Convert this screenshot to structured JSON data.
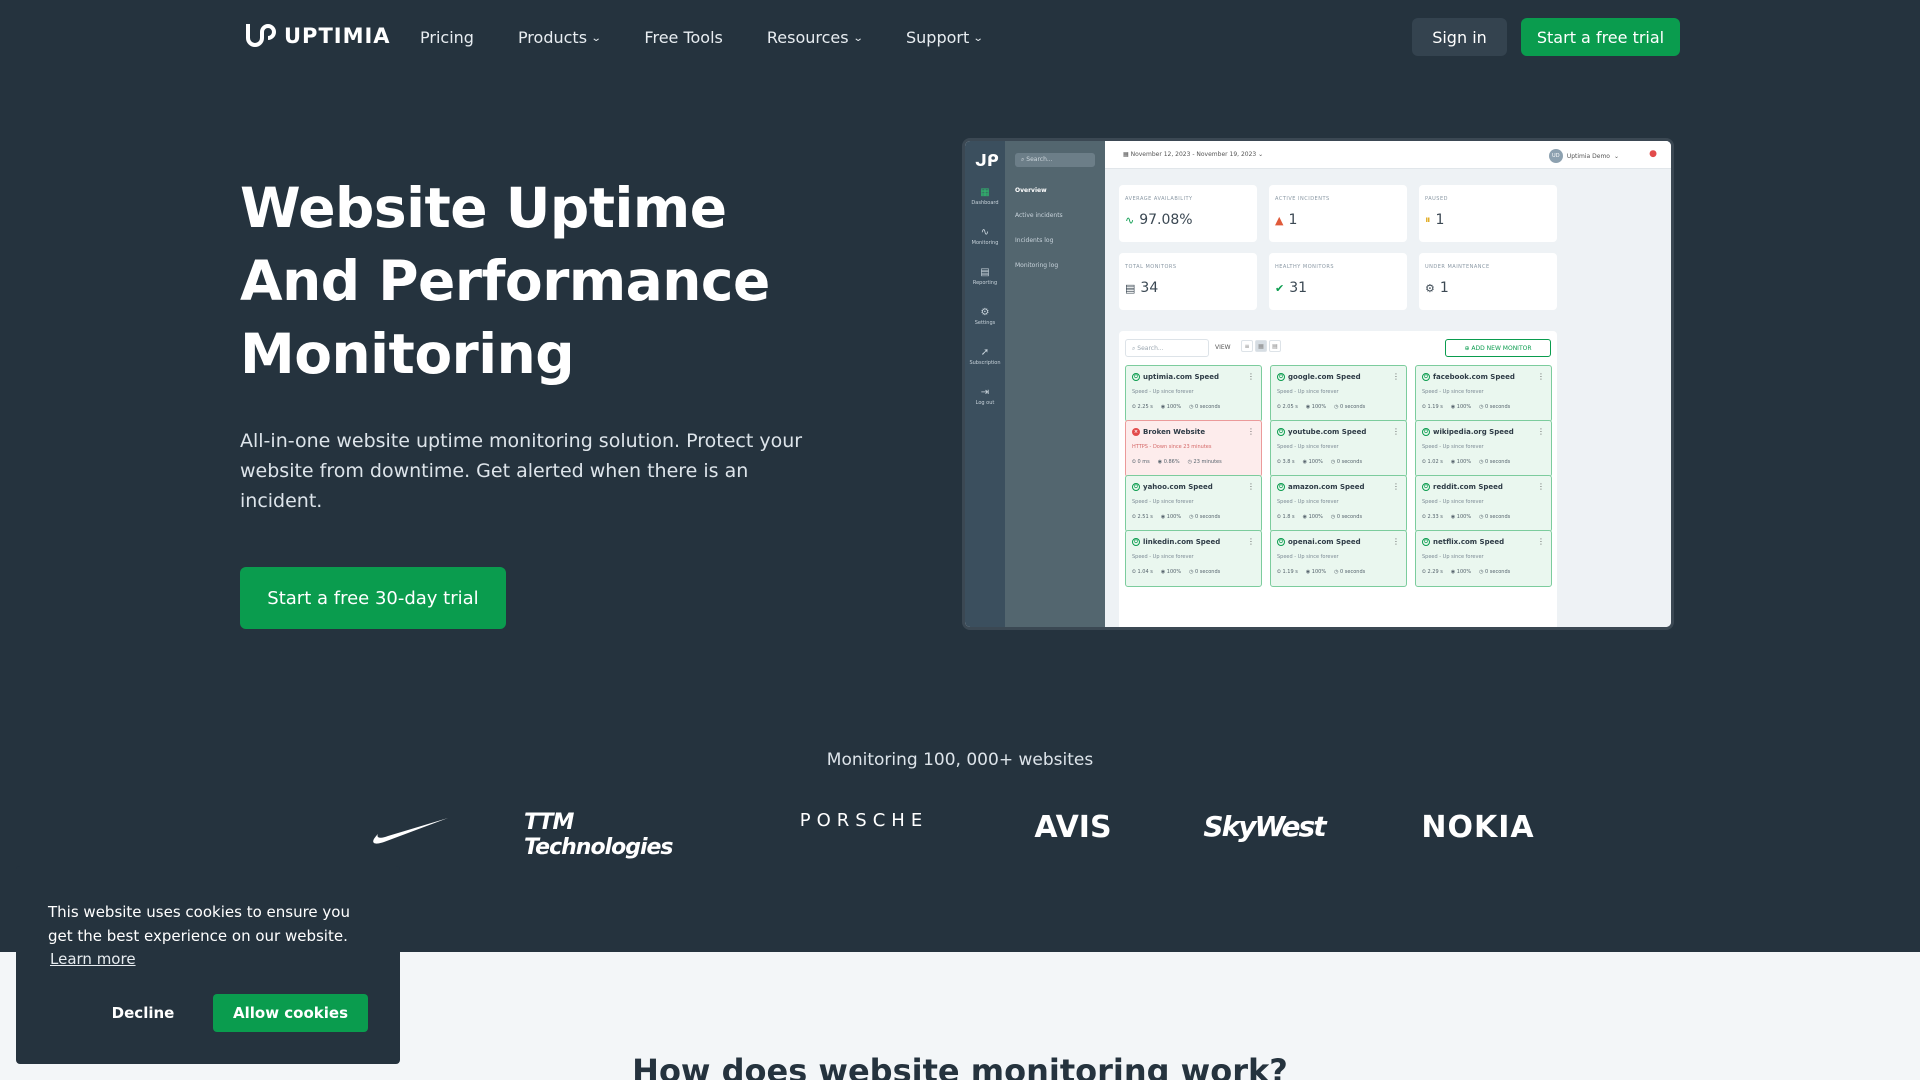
{
  "nav": {
    "logo_text": "UPTIMIA",
    "links": [
      {
        "label": "Pricing",
        "dropdown": false
      },
      {
        "label": "Products",
        "dropdown": true
      },
      {
        "label": "Free Tools",
        "dropdown": false
      },
      {
        "label": "Resources",
        "dropdown": true
      },
      {
        "label": "Support",
        "dropdown": true
      }
    ],
    "signin": "Sign in",
    "trial": "Start a free trial"
  },
  "hero": {
    "title_lines": [
      "Website Uptime",
      "And Performance",
      "Monitoring"
    ],
    "subtitle": "All-in-one website uptime monitoring solution. Protect your website from downtime. Get alerted when there is an incident.",
    "cta": "Start a free 30-day trial"
  },
  "dashboard": {
    "sidebar": [
      "Dashboard",
      "Monitoring",
      "Reporting",
      "Settings",
      "Subscription",
      "Log out"
    ],
    "search_placeholder": "Search...",
    "subnav": [
      "Overview",
      "Active incidents",
      "Incidents log",
      "Monitoring log"
    ],
    "date_range": "November 12, 2023 - November 19, 2023",
    "user": "Uptimia Demo",
    "user_initials": "UD",
    "stats": [
      {
        "label": "AVERAGE AVAILABILITY",
        "value": "97.08%",
        "icon": "pulse-icon",
        "color": "#0a9c4e"
      },
      {
        "label": "ACTIVE INCIDENTS",
        "value": "1",
        "icon": "warning-icon",
        "color": "#e05a3a"
      },
      {
        "label": "PAUSED",
        "value": "1",
        "icon": "pause-icon",
        "color": "#e0a91e"
      },
      {
        "label": "TOTAL MONITORS",
        "value": "34",
        "icon": "server-icon",
        "color": "#3b4853"
      },
      {
        "label": "HEALTHY MONITORS",
        "value": "31",
        "icon": "check-icon",
        "color": "#0a9c4e"
      },
      {
        "label": "UNDER MAINTENANCE",
        "value": "1",
        "icon": "gears-icon",
        "color": "#3b4853"
      }
    ],
    "panel": {
      "search": "Search...",
      "view": "VIEW",
      "add": "ADD NEW MONITOR"
    },
    "monitors": [
      {
        "name": "uptimia.com Speed",
        "status": "Speed - Up since forever",
        "m1": "2.25 s",
        "m2": "100%",
        "m3": "0 seconds",
        "down": false
      },
      {
        "name": "google.com Speed",
        "status": "Speed - Up since forever",
        "m1": "2.05 s",
        "m2": "100%",
        "m3": "0 seconds",
        "down": false
      },
      {
        "name": "facebook.com Speed",
        "status": "Speed - Up since forever",
        "m1": "1.19 s",
        "m2": "100%",
        "m3": "0 seconds",
        "down": false
      },
      {
        "name": "Broken Website",
        "status": "HTTPS - Down since 23 minutes",
        "m1": "0 ms",
        "m2": "0.86%",
        "m3": "23 minutes",
        "down": true
      },
      {
        "name": "youtube.com Speed",
        "status": "Speed - Up since forever",
        "m1": "3.8 s",
        "m2": "100%",
        "m3": "0 seconds",
        "down": false
      },
      {
        "name": "wikipedia.org Speed",
        "status": "Speed - Up since forever",
        "m1": "1.02 s",
        "m2": "100%",
        "m3": "0 seconds",
        "down": false
      },
      {
        "name": "yahoo.com Speed",
        "status": "Speed - Up since forever",
        "m1": "2.51 s",
        "m2": "100%",
        "m3": "0 seconds",
        "down": false
      },
      {
        "name": "amazon.com Speed",
        "status": "Speed - Up since forever",
        "m1": "1.8 s",
        "m2": "100%",
        "m3": "0 seconds",
        "down": false
      },
      {
        "name": "reddit.com Speed",
        "status": "Speed - Up since forever",
        "m1": "2.33 s",
        "m2": "100%",
        "m3": "0 seconds",
        "down": false
      },
      {
        "name": "linkedin.com Speed",
        "status": "Speed - Up since forever",
        "m1": "1.04 s",
        "m2": "100%",
        "m3": "0 seconds",
        "down": false
      },
      {
        "name": "openai.com Speed",
        "status": "Speed - Up since forever",
        "m1": "1.19 s",
        "m2": "100%",
        "m3": "0 seconds",
        "down": false
      },
      {
        "name": "netflix.com Speed",
        "status": "Speed - Up since forever",
        "m1": "2.29 s",
        "m2": "100%",
        "m3": "0 seconds",
        "down": false
      }
    ]
  },
  "clients": {
    "title": "Monitoring 100, 000+ websites",
    "logos": [
      {
        "name": "nike-logo",
        "text": ""
      },
      {
        "name": "ttm-logo",
        "text": "TTM Technologies"
      },
      {
        "name": "porsche-logo",
        "text": "PORSCHE"
      },
      {
        "name": "avis-logo",
        "text": "AVIS"
      },
      {
        "name": "skywest-logo",
        "text": "SkyWest"
      },
      {
        "name": "nokia-logo",
        "text": "NOKIA"
      }
    ]
  },
  "lower": {
    "title": "How does website monitoring work?"
  },
  "cookie": {
    "text": "This website uses cookies to ensure you get the best experience on our website.",
    "learn": "Learn more",
    "decline": "Decline",
    "allow": "Allow cookies"
  }
}
